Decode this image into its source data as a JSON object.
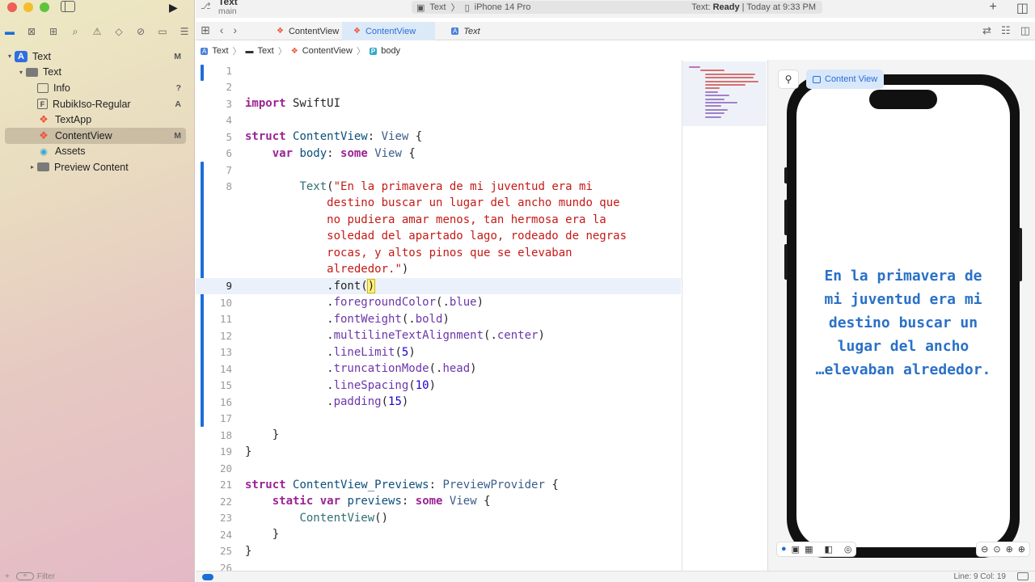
{
  "window": {
    "project_title": "Text",
    "branch": "main"
  },
  "status": {
    "target": "Text",
    "device": "iPhone 14 Pro",
    "state_label": "Text:",
    "state_value": "Ready",
    "timestamp": "| Today at 9:33 PM"
  },
  "navigator": {
    "items": [
      {
        "label": "Text",
        "badge": "M",
        "icon": "project-icon",
        "indent": 0,
        "disclosure": "▾"
      },
      {
        "label": "Text",
        "badge": "",
        "icon": "folder-icon",
        "indent": 1,
        "disclosure": "▾"
      },
      {
        "label": "Info",
        "badge": "?",
        "icon": "plist-icon",
        "indent": 2,
        "disclosure": ""
      },
      {
        "label": "RubikIso-Regular",
        "badge": "A",
        "icon": "font-file-icon",
        "indent": 2,
        "disclosure": ""
      },
      {
        "label": "TextApp",
        "badge": "",
        "icon": "swift-file-icon",
        "indent": 2,
        "disclosure": ""
      },
      {
        "label": "ContentView",
        "badge": "M",
        "icon": "swift-file-icon",
        "indent": 2,
        "disclosure": "",
        "selected": true
      },
      {
        "label": "Assets",
        "badge": "",
        "icon": "assets-icon",
        "indent": 2,
        "disclosure": ""
      },
      {
        "label": "Preview Content",
        "badge": "",
        "icon": "folder-icon",
        "indent": 2,
        "disclosure": "▸"
      }
    ],
    "filter_placeholder": "Filter"
  },
  "tabs": [
    {
      "label": "ContentView",
      "active": false
    },
    {
      "label": "ContentView",
      "active": true
    },
    {
      "label": "Text",
      "active": false
    }
  ],
  "breadcrumb": [
    "Text",
    "Text",
    "ContentView",
    "body"
  ],
  "code_lines": [
    {
      "n": "1",
      "html": ""
    },
    {
      "n": "2",
      "html": ""
    },
    {
      "n": "3",
      "html": "<span class=\"kw\">import</span> SwiftUI"
    },
    {
      "n": "4",
      "html": ""
    },
    {
      "n": "5",
      "html": "<span class=\"kw\">struct</span> <span class=\"tyb\">ContentView</span>: <span class=\"ty\">View</span> {"
    },
    {
      "n": "6",
      "html": "    <span class=\"kw\">var</span> <span class=\"tyb\">body</span>: <span class=\"kw\">some</span> <span class=\"ty\">View</span> {"
    },
    {
      "n": "7",
      "html": ""
    },
    {
      "n": "8",
      "html": "        <span class=\"fn2\">Text</span>(<span class=\"str\">\"En la primavera de mi juventud era mi</span>"
    },
    {
      "n": "",
      "html": "            <span class=\"str\">destino buscar un lugar del ancho mundo que</span>"
    },
    {
      "n": "",
      "html": "            <span class=\"str\">no pudiera amar menos, tan hermosa era la</span>"
    },
    {
      "n": "",
      "html": "            <span class=\"str\">soledad del apartado lago, rodeado de negras</span>"
    },
    {
      "n": "",
      "html": "            <span class=\"str\">rocas, y altos pinos que se elevaban</span>"
    },
    {
      "n": "",
      "html": "            <span class=\"str\">alrededor.\"</span>)"
    },
    {
      "n": "9",
      "html": "            .font(<span class=\"cursor\">)</span>",
      "current": true
    },
    {
      "n": "10",
      "html": "            .<span class=\"fn\">foregroundColor</span>(.<span class=\"fn\">blue</span>)"
    },
    {
      "n": "11",
      "html": "            .<span class=\"fn\">fontWeight</span>(.<span class=\"fn\">bold</span>)"
    },
    {
      "n": "12",
      "html": "            .<span class=\"fn\">multilineTextAlignment</span>(.<span class=\"fn\">center</span>)"
    },
    {
      "n": "13",
      "html": "            .<span class=\"fn\">lineLimit</span>(<span class=\"num\">5</span>)"
    },
    {
      "n": "14",
      "html": "            .<span class=\"fn\">truncationMode</span>(.<span class=\"fn\">head</span>)"
    },
    {
      "n": "15",
      "html": "            .<span class=\"fn\">lineSpacing</span>(<span class=\"num\">10</span>)"
    },
    {
      "n": "16",
      "html": "            .<span class=\"fn\">padding</span>(<span class=\"num\">15</span>)"
    },
    {
      "n": "17",
      "html": ""
    },
    {
      "n": "18",
      "html": "    }"
    },
    {
      "n": "19",
      "html": "}"
    },
    {
      "n": "20",
      "html": ""
    },
    {
      "n": "21",
      "html": "<span class=\"kw\">struct</span> <span class=\"tyb\">ContentView_Previews</span>: <span class=\"ty\">PreviewProvider</span> {"
    },
    {
      "n": "22",
      "html": "    <span class=\"kw\">static</span> <span class=\"kw\">var</span> <span class=\"tyb\">previews</span>: <span class=\"kw\">some</span> <span class=\"ty\">View</span> {"
    },
    {
      "n": "23",
      "html": "        <span class=\"fn2\">ContentView</span>()"
    },
    {
      "n": "24",
      "html": "    }"
    },
    {
      "n": "25",
      "html": "}"
    },
    {
      "n": "26",
      "html": ""
    }
  ],
  "canvas": {
    "chip_label": "Content View",
    "preview_lines": [
      "En la primavera de",
      "mi juventud era mi",
      "destino buscar un",
      "lugar del ancho",
      "…elevaban alrededor."
    ],
    "preview_color": "#2a71c7"
  },
  "statusbar": {
    "position": "Line: 9  Col: 19"
  },
  "colors": {
    "accent": "#1b6ed8",
    "keyword": "#9b2393",
    "string": "#c41a16"
  }
}
